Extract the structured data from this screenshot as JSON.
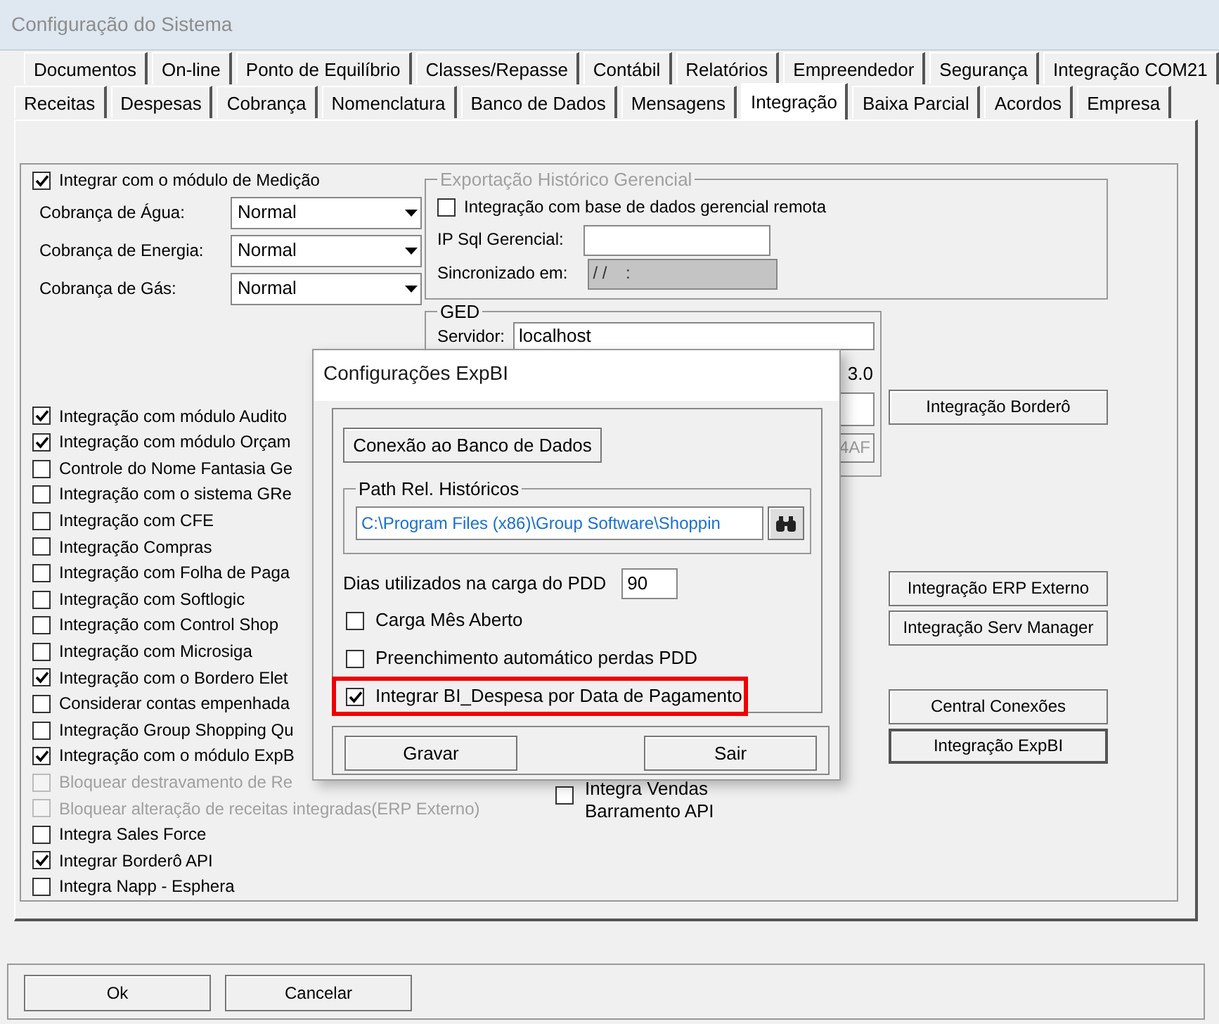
{
  "window": {
    "title": "Configuração do Sistema"
  },
  "tabs_back": [
    {
      "label": "Documentos",
      "selected": false
    },
    {
      "label": "On-line",
      "selected": false
    },
    {
      "label": "Ponto de Equilíbrio",
      "selected": false
    },
    {
      "label": "Classes/Repasse",
      "selected": false
    },
    {
      "label": "Contábil",
      "selected": false
    },
    {
      "label": "Relatórios",
      "selected": false
    },
    {
      "label": "Empreendedor",
      "selected": false
    },
    {
      "label": "Segurança",
      "selected": false
    },
    {
      "label": "Integração COM21",
      "selected": false
    }
  ],
  "tabs_front": [
    {
      "label": "Receitas",
      "selected": false
    },
    {
      "label": "Despesas",
      "selected": false
    },
    {
      "label": "Cobrança",
      "selected": false
    },
    {
      "label": "Nomenclatura",
      "selected": false
    },
    {
      "label": "Banco de Dados",
      "selected": false
    },
    {
      "label": "Mensagens",
      "selected": false
    },
    {
      "label": "Integração",
      "selected": true
    },
    {
      "label": "Baixa Parcial",
      "selected": false
    },
    {
      "label": "Acordos",
      "selected": false
    },
    {
      "label": "Empresa",
      "selected": false
    }
  ],
  "medicao": {
    "label": "Integrar com o módulo de Medição",
    "checked": true,
    "disabled": false
  },
  "combos": [
    {
      "label": "Cobrança de Água:",
      "value": "Normal"
    },
    {
      "label": "Cobrança de Energia:",
      "value": "Normal"
    },
    {
      "label": "Cobrança de Gás:",
      "value": "Normal"
    }
  ],
  "options": [
    {
      "label": "Integração com módulo Audito",
      "checked": true,
      "disabled": false
    },
    {
      "label": "Integração com módulo Orçam",
      "checked": true,
      "disabled": false
    },
    {
      "label": "Controle do Nome Fantasia Ge",
      "checked": false,
      "disabled": false
    },
    {
      "label": "Integração com o sistema GRe",
      "checked": false,
      "disabled": false
    },
    {
      "label": "Integração com CFE",
      "checked": false,
      "disabled": false
    },
    {
      "label": "Integração Compras",
      "checked": false,
      "disabled": false
    },
    {
      "label": "Integração com Folha de Paga",
      "checked": false,
      "disabled": false
    },
    {
      "label": "Integração com Softlogic",
      "checked": false,
      "disabled": false
    },
    {
      "label": "Integração com Control Shop",
      "checked": false,
      "disabled": false
    },
    {
      "label": "Integração com Microsiga",
      "checked": false,
      "disabled": false
    },
    {
      "label": "Integração com o Bordero Elet",
      "checked": true,
      "disabled": false
    },
    {
      "label": "Considerar contas empenhada",
      "checked": false,
      "disabled": false
    },
    {
      "label": "Integração Group Shopping Qu",
      "checked": false,
      "disabled": false
    },
    {
      "label": "Integração com o módulo ExpB",
      "checked": true,
      "disabled": false
    },
    {
      "label": "Bloquear destravamento de Re",
      "checked": false,
      "disabled": true
    },
    {
      "label": "Bloquear alteração de receitas integradas(ERP Externo)",
      "checked": false,
      "disabled": true
    },
    {
      "label": "Integra Sales Force",
      "checked": false,
      "disabled": false
    },
    {
      "label": "Integrar Borderô API",
      "checked": true,
      "disabled": false
    },
    {
      "label": "Integra Napp - Esphera",
      "checked": false,
      "disabled": false
    }
  ],
  "export_group": {
    "legend": "Exportação Histórico Gerencial",
    "disabled": true,
    "remote": {
      "label": "Integração com base de dados gerencial remota",
      "checked": false,
      "disabled": false
    },
    "ip_label": "IP Sql Gerencial:",
    "sync_label": "Sincronizado em:",
    "sync_value": "/ /    :"
  },
  "ged": {
    "legend": "GED",
    "server_label": "Servidor:",
    "server_value": "localhost",
    "version": "3.0",
    "code": "4AF"
  },
  "side_buttons": [
    [
      {
        "label": "Integração Borderô",
        "focused": false
      }
    ],
    [
      {
        "label": "Integração ERP Externo",
        "focused": false
      },
      {
        "label": "Integração Serv Manager",
        "focused": false
      }
    ],
    [
      {
        "label": "Central Conexões",
        "focused": false
      },
      {
        "label": "Integração ExpBI",
        "focused": true
      }
    ]
  ],
  "vendas": {
    "lines": [
      "Integra Vendas",
      "Barramento API"
    ],
    "checked": false,
    "disabled": false
  },
  "footer_buttons": [
    "Ok",
    "Cancelar"
  ],
  "dialog": {
    "title": "Configurações ExpBI",
    "db_button": "Conexão ao Banco de Dados",
    "path": {
      "legend": "Path Rel. Históricos",
      "value": "C:\\Program Files (x86)\\Group Software\\Shoppin"
    },
    "days": {
      "label": "Dias utilizados na carga do PDD",
      "value": "90"
    },
    "checks": [
      {
        "label": "Carga Mês Aberto",
        "checked": false,
        "disabled": false,
        "highlighted": false
      },
      {
        "label": "Preenchimento automático perdas PDD",
        "checked": false,
        "disabled": false,
        "highlighted": false
      },
      {
        "label": "Integrar BI_Despesa por Data de Pagamento",
        "checked": true,
        "disabled": false,
        "highlighted": true
      }
    ],
    "buttons": [
      "Gravar",
      "Sair"
    ]
  }
}
